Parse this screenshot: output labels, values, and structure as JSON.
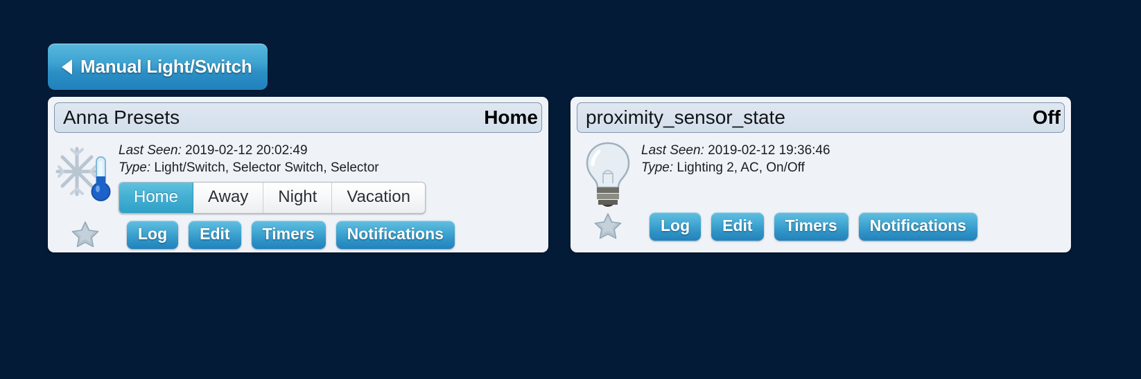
{
  "page": {
    "background_color": "#041b38",
    "accent_color": "#2f93c6",
    "active_segment_color": "#44b0d3"
  },
  "breadcrumb": {
    "back_icon": "back-arrow-icon",
    "label": "Manual Light/Switch"
  },
  "cards": [
    {
      "title": "Anna Presets",
      "status": "Home",
      "icon": "snowflake-thermometer-icon",
      "meta": [
        {
          "key": "Last Seen:",
          "value": "2019-02-12 20:02:49"
        },
        {
          "key": "Type:",
          "value": "Light/Switch, Selector Switch, Selector"
        }
      ],
      "selector": {
        "options": [
          "Home",
          "Away",
          "Night",
          "Vacation"
        ],
        "selected": "Home"
      },
      "favorite_icon": "star-icon",
      "actions": [
        "Log",
        "Edit",
        "Timers",
        "Notifications"
      ]
    },
    {
      "title": "proximity_sensor_state",
      "status": "Off",
      "icon": "light-bulb-icon",
      "meta": [
        {
          "key": "Last Seen:",
          "value": "2019-02-12 19:36:46"
        },
        {
          "key": "Type:",
          "value": "Lighting 2, AC, On/Off"
        }
      ],
      "selector": null,
      "favorite_icon": "star-icon",
      "actions": [
        "Log",
        "Edit",
        "Timers",
        "Notifications"
      ]
    }
  ]
}
